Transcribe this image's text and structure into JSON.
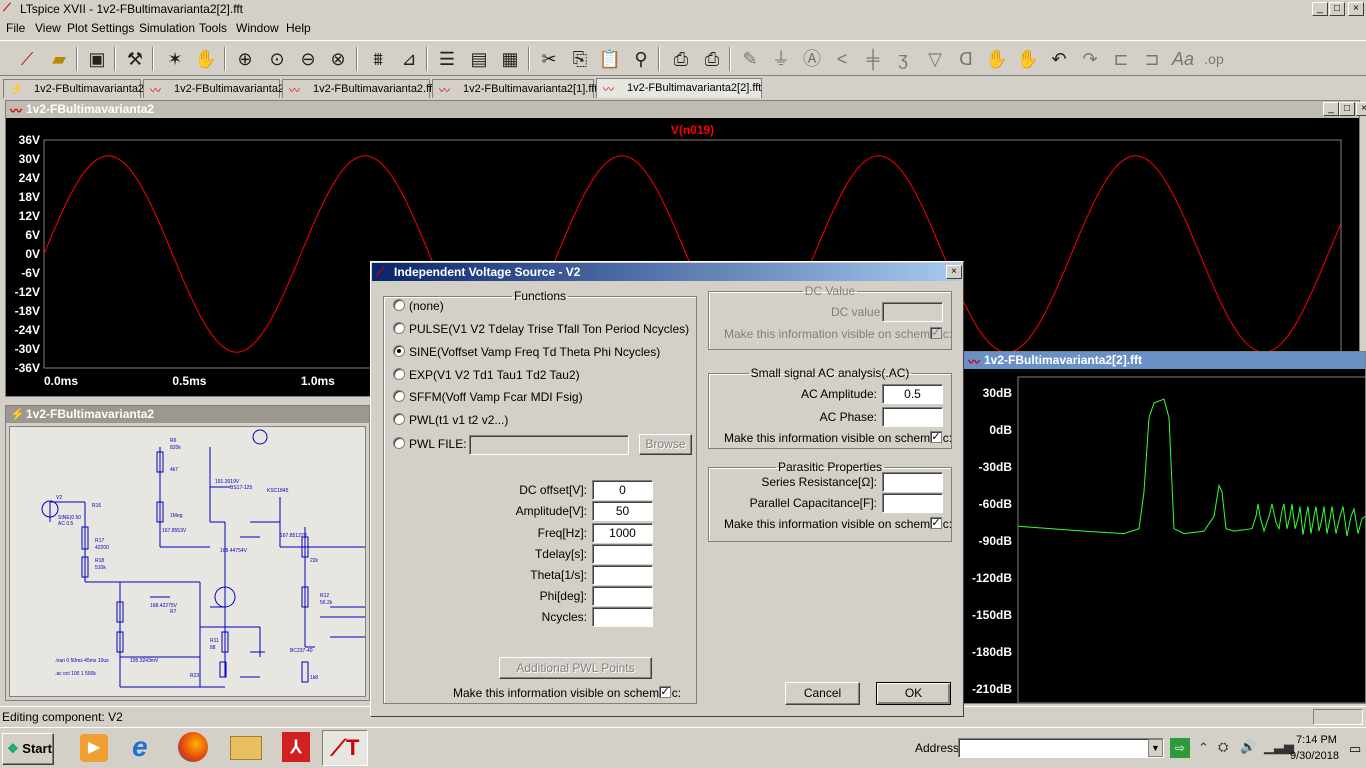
{
  "app": {
    "title": "LTspice XVII - 1v2-FBultimavarianta2[2].fft"
  },
  "menu": [
    "File",
    "View",
    "Plot Settings",
    "Simulation",
    "Tools",
    "Window",
    "Help"
  ],
  "tabs": [
    "1v2-FBultimavarianta2",
    "1v2-FBultimavarianta2",
    "1v2-FBultimavarianta2.fft",
    "1v2-FBultimavarianta2[1].fft",
    "1v2-FBultimavarianta2[2].fft"
  ],
  "plot1": {
    "title": "1v2-FBultimavarianta2",
    "trace_label": "V(n019)",
    "trace_color": "#ff0000"
  },
  "chart_data": [
    {
      "type": "line",
      "title": "V(n019)",
      "yticks": [
        "36V",
        "30V",
        "24V",
        "18V",
        "12V",
        "6V",
        "0V",
        "-6V",
        "-12V",
        "-18V",
        "-24V",
        "-30V",
        "-36V"
      ],
      "xticks": [
        "0.0ms",
        "0.5ms",
        "1.0ms"
      ],
      "ylim": [
        -36,
        36
      ],
      "xlim": [
        0,
        5.05
      ],
      "series": [
        {
          "amplitude": 31,
          "frequency_hz": 1000,
          "unit": "V"
        }
      ]
    },
    {
      "type": "line",
      "yticks": [
        "30dB",
        "0dB",
        "-30dB",
        "-60dB",
        "-90dB",
        "-120dB",
        "-150dB",
        "-180dB",
        "-210dB"
      ],
      "ylim": [
        -210,
        30
      ]
    }
  ],
  "schematic": {
    "title": "1v2-FBultimavarianta2",
    "directive1": ".tran 0 50ms 45ms 10us",
    "directive2": ".ac oct 100 1 500k"
  },
  "plot2": {
    "title": "1v2-FBultimavarianta2[2].fft"
  },
  "status": "Editing component: V2",
  "dialog": {
    "title": "Independent Voltage Source - V2",
    "functions_legend": "Functions",
    "functions": [
      {
        "label": "(none)",
        "selected": false
      },
      {
        "label": "PULSE(V1 V2 Tdelay Trise Tfall Ton Period Ncycles)",
        "selected": false
      },
      {
        "label": "SINE(Voffset Vamp Freq Td Theta Phi Ncycles)",
        "selected": true
      },
      {
        "label": "EXP(V1 V2 Td1 Tau1 Td2 Tau2)",
        "selected": false
      },
      {
        "label": "SFFM(Voff Vamp Fcar MDI Fsig)",
        "selected": false
      },
      {
        "label": "PWL(t1 v1 t2 v2...)",
        "selected": false
      },
      {
        "label": "PWL FILE:",
        "selected": false
      }
    ],
    "browse": "Browse",
    "params": [
      {
        "label": "DC offset[V]:",
        "value": "0"
      },
      {
        "label": "Amplitude[V]:",
        "value": "50"
      },
      {
        "label": "Freq[Hz]:",
        "value": "1000"
      },
      {
        "label": "Tdelay[s]:",
        "value": ""
      },
      {
        "label": "Theta[1/s]:",
        "value": ""
      },
      {
        "label": "Phi[deg]:",
        "value": ""
      },
      {
        "label": "Ncycles:",
        "value": ""
      }
    ],
    "additional_pwl": "Additional PWL Points",
    "visible_label": "Make this information visible on schematic:",
    "dc_legend": "DC Value",
    "dc_value_label": "DC value:",
    "ac_legend": "Small signal AC analysis(.AC)",
    "ac_amplitude_label": "AC Amplitude:",
    "ac_amplitude": "0.5",
    "ac_phase_label": "AC Phase:",
    "parasitic_legend": "Parasitic Properties",
    "series_res_label": "Series Resistance[Ω]:",
    "parallel_cap_label": "Parallel Capacitance[F]:",
    "cancel": "Cancel",
    "ok": "OK"
  },
  "taskbar": {
    "start": "Start",
    "address_label": "Address",
    "time": "7:14 PM",
    "date": "9/30/2018"
  }
}
